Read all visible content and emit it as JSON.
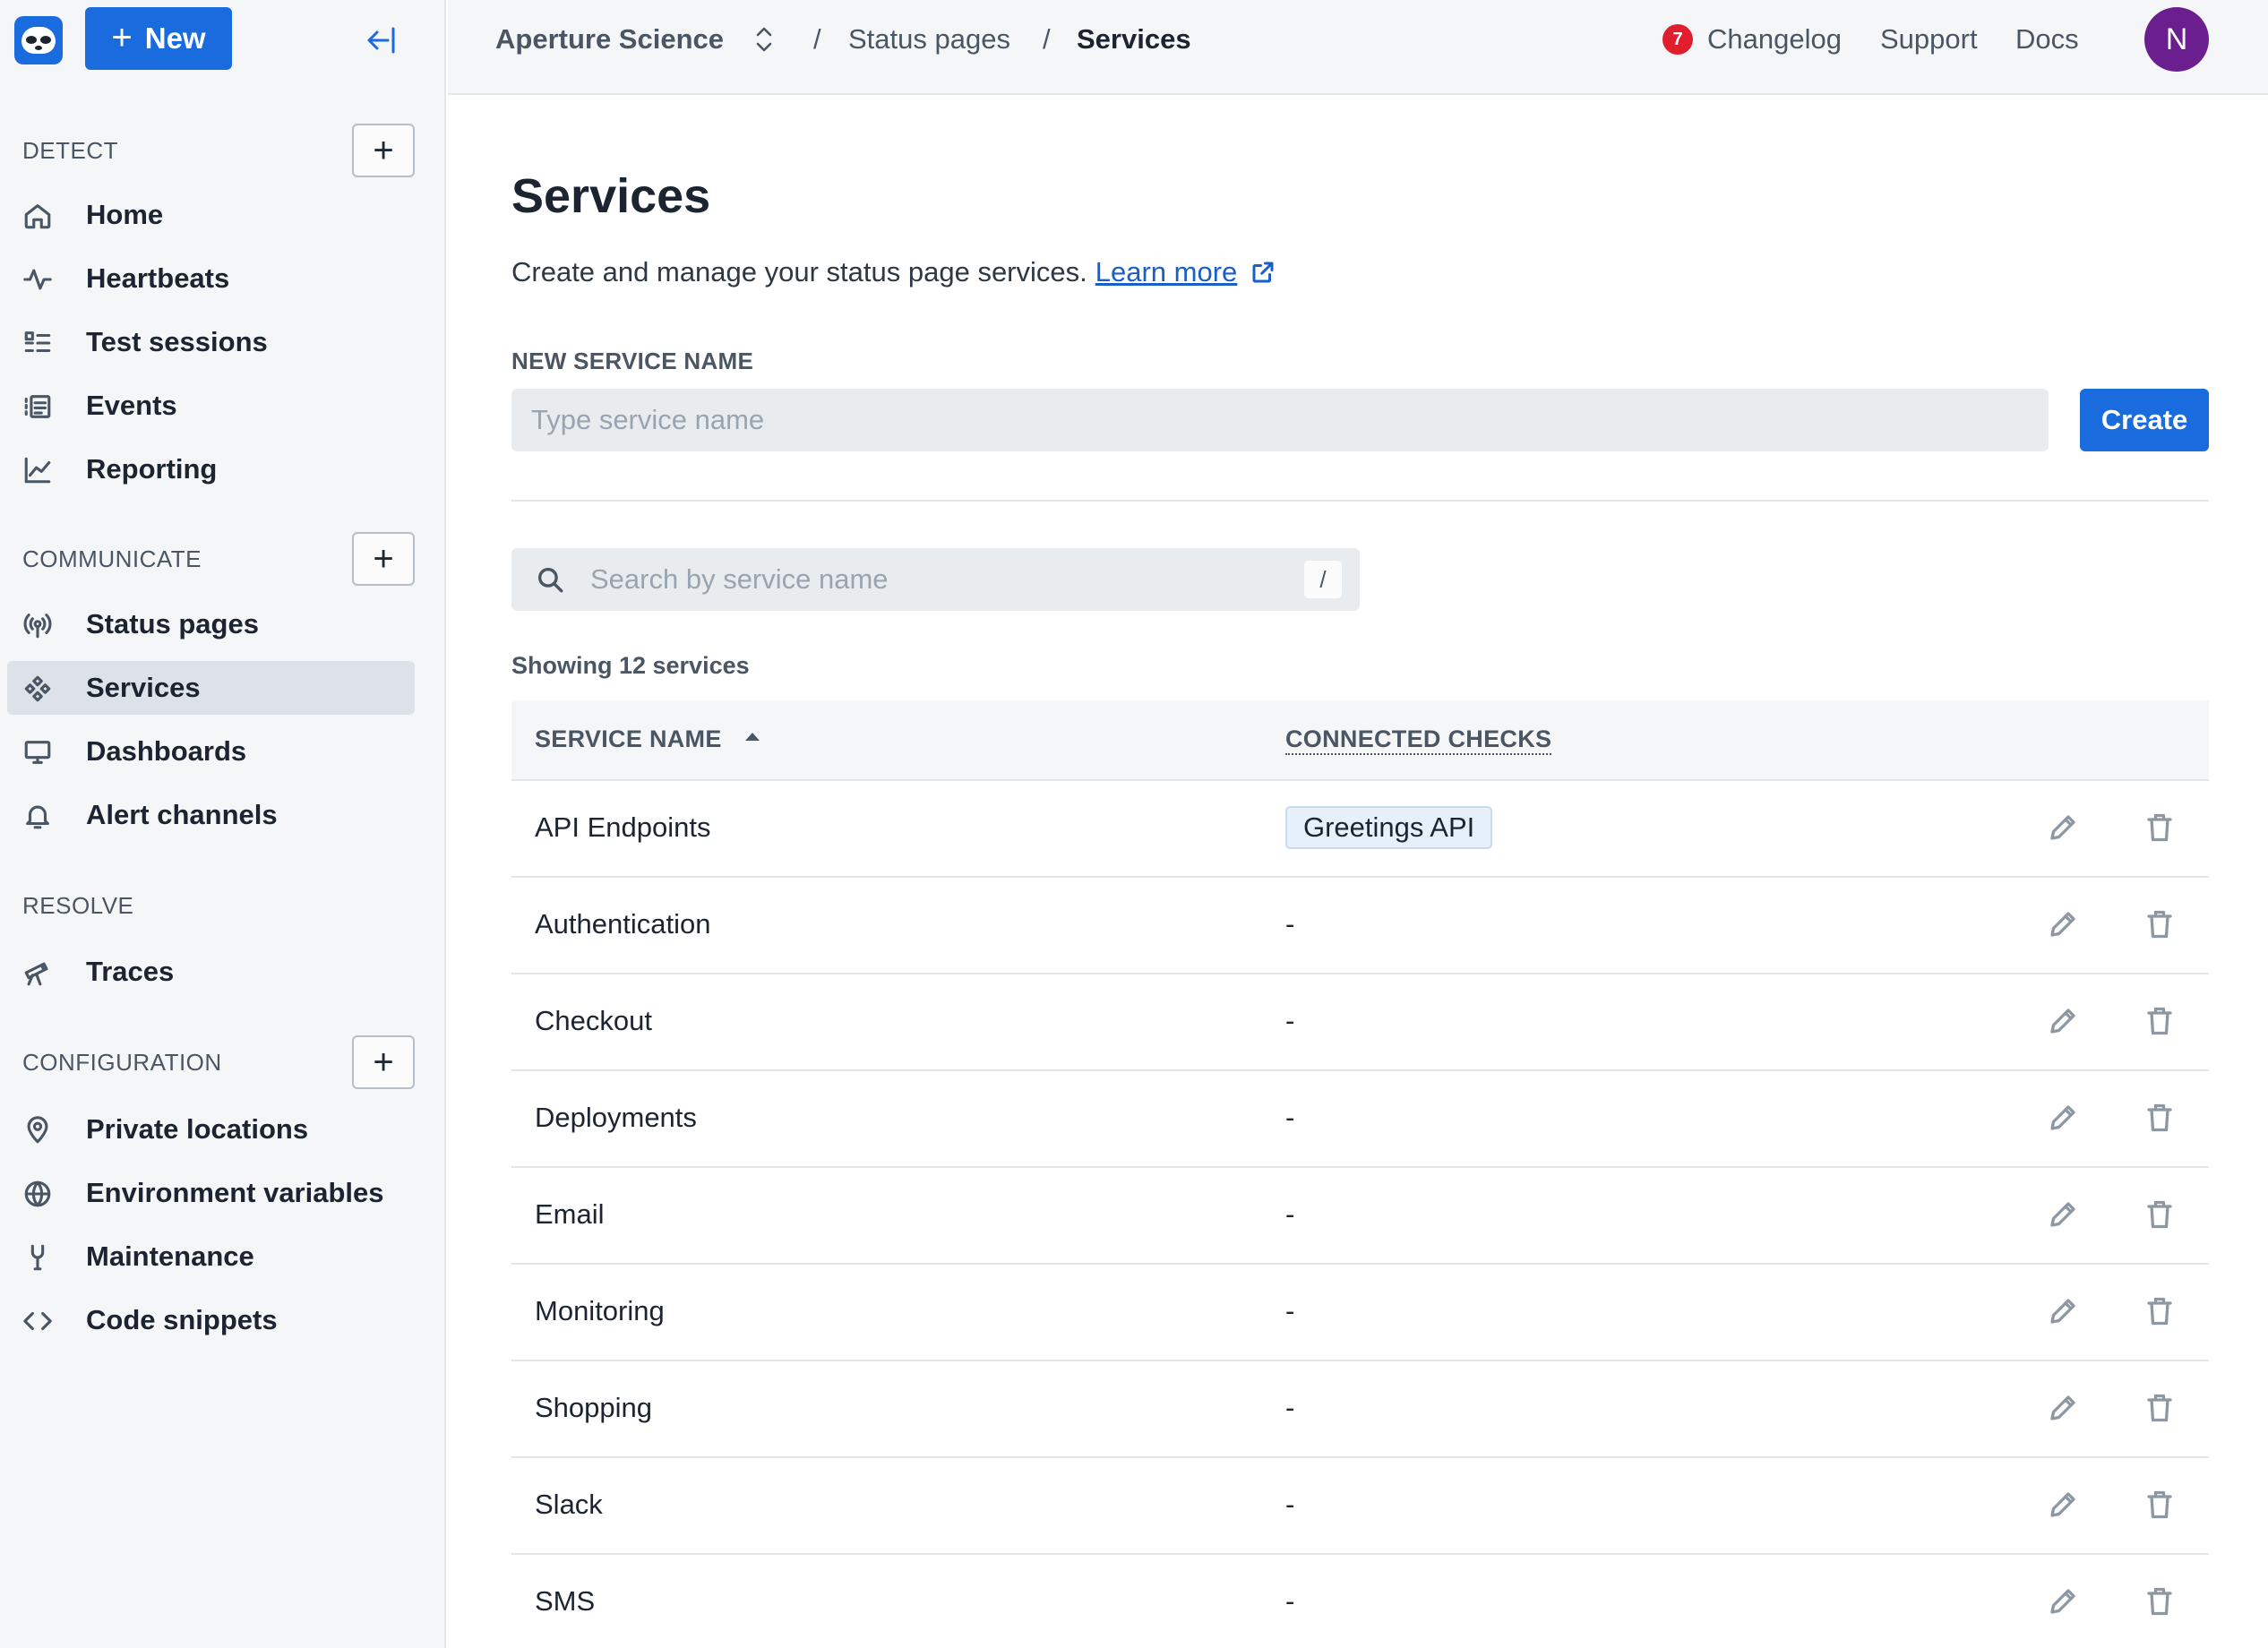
{
  "header": {
    "new_label": "New",
    "org": "Aperture Science",
    "breadcrumb": {
      "sep": "/",
      "parent": "Status pages",
      "current": "Services"
    },
    "changelog_badge": "7",
    "links": {
      "changelog": "Changelog",
      "support": "Support",
      "docs": "Docs"
    },
    "avatar_initial": "N"
  },
  "sidebar": {
    "sections": {
      "detect": "DETECT",
      "communicate": "COMMUNICATE",
      "resolve": "RESOLVE",
      "configuration": "CONFIGURATION"
    },
    "items": {
      "home": "Home",
      "heartbeats": "Heartbeats",
      "test_sessions": "Test sessions",
      "events": "Events",
      "reporting": "Reporting",
      "status_pages": "Status pages",
      "services": "Services",
      "dashboards": "Dashboards",
      "alert_channels": "Alert channels",
      "traces": "Traces",
      "private_locations": "Private locations",
      "environment_variables": "Environment variables",
      "maintenance": "Maintenance",
      "code_snippets": "Code snippets"
    },
    "active_item": "Services"
  },
  "main": {
    "title": "Services",
    "description": "Create and manage your status page services.",
    "learn_more": "Learn more",
    "new_service_label": "NEW SERVICE NAME",
    "new_service_placeholder": "Type service name",
    "create_label": "Create",
    "search_placeholder": "Search by service name",
    "search_shortcut": "/",
    "showing_text": "Showing 12 services",
    "table": {
      "col_name": "SERVICE NAME",
      "col_checks": "CONNECTED CHECKS",
      "rows": [
        {
          "name": "API Endpoints",
          "checks": "Greetings API"
        },
        {
          "name": "Authentication",
          "checks": "-"
        },
        {
          "name": "Checkout",
          "checks": "-"
        },
        {
          "name": "Deployments",
          "checks": "-"
        },
        {
          "name": "Email",
          "checks": "-"
        },
        {
          "name": "Monitoring",
          "checks": "-"
        },
        {
          "name": "Shopping",
          "checks": "-"
        },
        {
          "name": "Slack",
          "checks": "-"
        },
        {
          "name": "SMS",
          "checks": "-"
        }
      ]
    }
  },
  "colors": {
    "primary": "#1a6bde",
    "badge": "#e01e2e",
    "avatar": "#6b1f8e",
    "chip_bg": "#e6f0fb"
  }
}
